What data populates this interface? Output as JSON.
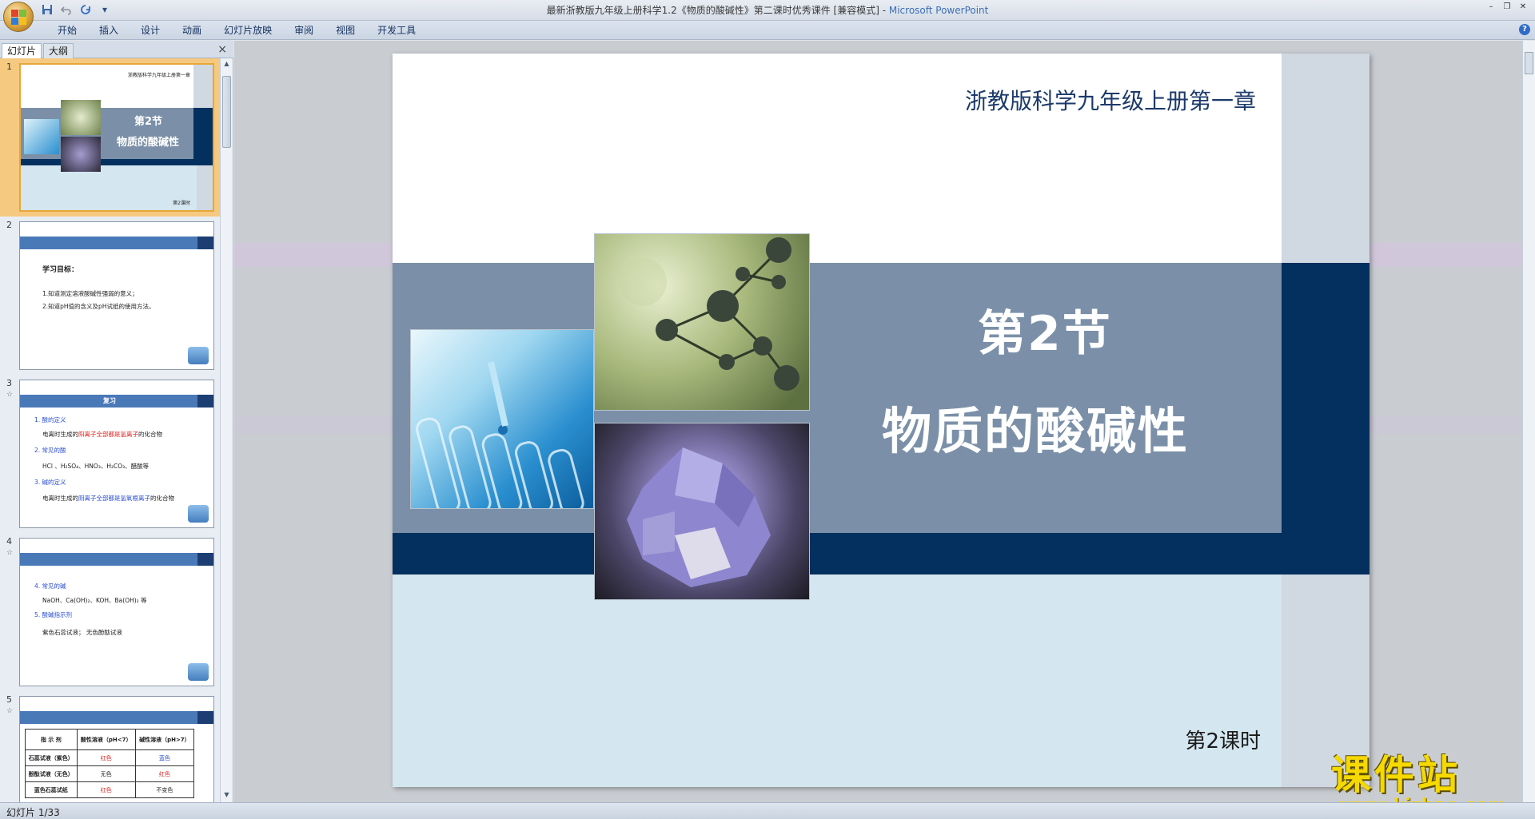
{
  "window": {
    "title": "最新浙教版九年级上册科学1.2《物质的酸碱性》第二课时优秀课件 [兼容模式]",
    "title_sep": " - ",
    "app_name": "Microsoft PowerPoint"
  },
  "quick_access": [
    "save-icon",
    "undo-icon",
    "redo-icon",
    "customize-icon"
  ],
  "ribbon": {
    "tabs": [
      "开始",
      "插入",
      "设计",
      "动画",
      "幻灯片放映",
      "审阅",
      "视图",
      "开发工具"
    ]
  },
  "panel": {
    "tab_slides": "幻灯片",
    "tab_outline": "大纲",
    "close": "×"
  },
  "thumbnails": [
    {
      "num": "1",
      "header": "浙教版科学九年级上册第一章",
      "title1": "第2节",
      "title2": "物质的酸碱性",
      "footer": "第2课时"
    },
    {
      "num": "2",
      "heading": "学习目标：",
      "lines": [
        "1.知道测定溶液酸碱性强弱的意义；",
        "2.知道pH值的含义及pH试纸的使用方法。"
      ]
    },
    {
      "num": "3",
      "band_title": "复习",
      "items": [
        {
          "head": "1. 酸的定义",
          "body_pre": "电离时生成的",
          "body_hl": "阳离子全部都是氢离子",
          "body_post": "的化合物"
        },
        {
          "head": "2. 常见的酸",
          "body_pre": "HCl 、H₂SO₄、HNO₃、H₂CO₃、醋酸等",
          "body_hl": "",
          "body_post": ""
        },
        {
          "head": "3. 碱的定义",
          "body_pre": "电离时生成的",
          "body_hl": "阴离子全部都是氢氧根离子",
          "body_post": "的化合物"
        }
      ]
    },
    {
      "num": "4",
      "items": [
        {
          "head": "4. 常见的碱",
          "body": "NaOH、Ca(OH)₂、KOH、Ba(OH)₂ 等"
        },
        {
          "head": "5. 酸碱指示剂",
          "body": "紫色石蕊试液；      无色酚酞试液"
        }
      ]
    },
    {
      "num": "5",
      "table": {
        "headers": [
          "指 示 剂",
          "酸性溶液（pH<7）",
          "碱性溶液（pH>7）"
        ],
        "rows": [
          [
            "石蕊试液（紫色）",
            "红色",
            "蓝色"
          ],
          [
            "酚酞试液（无色）",
            "无色",
            "红色"
          ],
          [
            "蓝色石蕊试纸",
            "红色",
            "不变色"
          ]
        ]
      }
    }
  ],
  "slide": {
    "subtitle": "浙教版科学九年级上册第一章",
    "title1": "第2节",
    "title2": "物质的酸碱性",
    "lesson": "第2课时"
  },
  "watermark": {
    "text": "课件站",
    "url": "www.kjzhan.com"
  },
  "status": {
    "slide_indicator": "幻灯片 1/33"
  },
  "colors": {
    "band_mid": "#7b90a8",
    "band_dark": "#04305f",
    "band_bottom": "#d4e6ef",
    "title_text": "#1c3a6a",
    "selection": "#f6c980"
  }
}
